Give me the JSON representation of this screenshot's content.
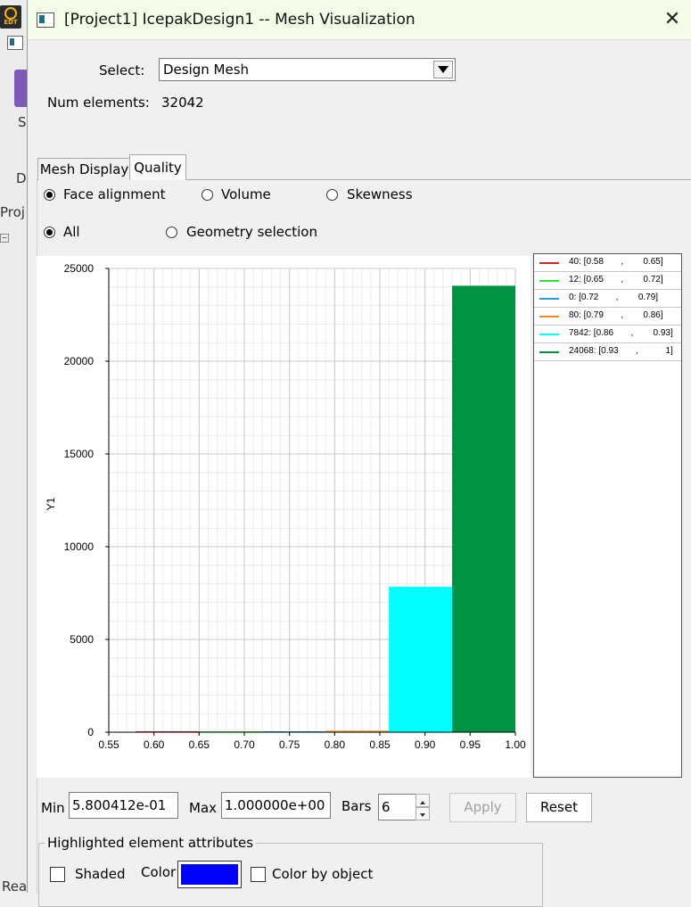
{
  "background_app": {
    "logo_text": "EDT",
    "fragments": [
      "S",
      "D",
      "Proj",
      "Rea"
    ]
  },
  "window": {
    "title": "[Project1] IcepakDesign1 -- Mesh Visualization",
    "close_glyph": "✕"
  },
  "select": {
    "label": "Select:",
    "value": "Design Mesh"
  },
  "num_elements": {
    "label": "Num elements:",
    "value": "32042"
  },
  "tabs": [
    {
      "label": "Mesh Display",
      "active": false
    },
    {
      "label": "Quality",
      "active": true
    }
  ],
  "quality_metric": {
    "options": [
      "Face alignment",
      "Volume",
      "Skewness"
    ],
    "selected": "Face alignment"
  },
  "scope": {
    "options": [
      "All",
      "Geometry selection"
    ],
    "selected": "All"
  },
  "chart_data": {
    "type": "bar",
    "ylabel": "Y1",
    "xlabel": "",
    "xlim": [
      0.55,
      1.0
    ],
    "ylim": [
      0,
      25000
    ],
    "xticks": [
      "0.55",
      "0.60",
      "0.65",
      "0.70",
      "0.75",
      "0.80",
      "0.85",
      "0.90",
      "0.95",
      "1.00"
    ],
    "yticks": [
      "0",
      "5000",
      "10000",
      "15000",
      "20000",
      "25000"
    ],
    "grid": true,
    "legend_position": "right",
    "bins": [
      {
        "x0": 0.58,
        "x1": 0.65,
        "value": 40,
        "color": "#d62728",
        "legend": "40: [0.58       ,        0.65]"
      },
      {
        "x0": 0.65,
        "x1": 0.72,
        "value": 12,
        "color": "#2ee82e",
        "legend": "12: [0.65       ,        0.72]"
      },
      {
        "x0": 0.72,
        "x1": 0.79,
        "value": 0,
        "color": "#1f9fe0",
        "legend": "0: [0.72       ,        0.79]"
      },
      {
        "x0": 0.79,
        "x1": 0.86,
        "value": 80,
        "color": "#f28c1e",
        "legend": "80: [0.79       ,        0.86]"
      },
      {
        "x0": 0.86,
        "x1": 0.93,
        "value": 7842,
        "color": "#00ffff",
        "legend": "7842: [0.86       ,        0.93]"
      },
      {
        "x0": 0.93,
        "x1": 1.0,
        "value": 24068,
        "color": "#009245",
        "legend": "24068: [0.93       ,           1]"
      }
    ]
  },
  "range": {
    "min_label": "Min",
    "min_value": "5.800412e-01",
    "max_label": "Max",
    "max_value": "1.000000e+00",
    "bars_label": "Bars",
    "bars_value": "6"
  },
  "buttons": {
    "apply": "Apply",
    "reset": "Reset"
  },
  "highlight": {
    "title": "Highlighted element attributes",
    "shaded_label": "Shaded",
    "color_label": "Color",
    "color_value": "#0000ff",
    "color_by_object_label": "Color by object"
  }
}
